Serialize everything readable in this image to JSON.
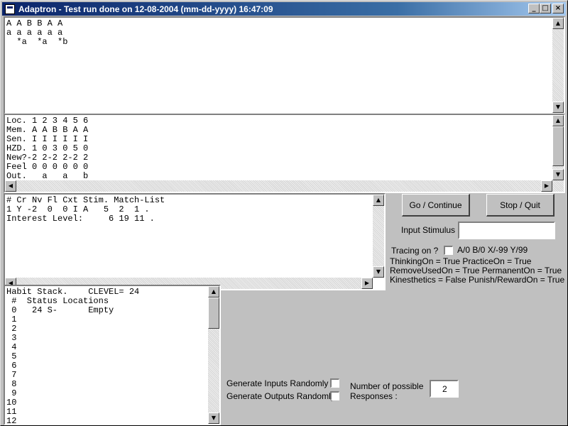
{
  "window": {
    "title": "Adaptron - Test run done on 12-08-2004 (mm-dd-yyyy) 16:47:09",
    "controls": {
      "minimize": "_",
      "maximize": "□",
      "close": "×"
    }
  },
  "top_output": {
    "lines": "A A B B A A\na a a a a a\n  *a  *a  *b"
  },
  "memory_table": {
    "lines": "Loc. 1 2 3 4 5 6\nMem. A A B B A A\nSen. I I I I I I\nHZD. 1 0 3 0 5 0\nNew?-2 2-2 2-2 2\nFeel 0 0 0 0 0 0\nOut.   a   a   b"
  },
  "match_list": {
    "lines": "# Cr Nv Fl Cxt Stim. Match-List\n1 Y -2  0  0 I A   5  2  1 .\nInterest Level:     6 19 11 ."
  },
  "habit_stack": {
    "lines": "Habit Stack.    CLEVEL= 24\n #  Status Locations\n 0   24 S-      Empty\n 1\n 2\n 3\n 4\n 5\n 6\n 7\n 8\n 9\n10\n11\n12"
  },
  "controls": {
    "go_continue": "Go / Continue",
    "stop_quit": "Stop / Quit",
    "input_stimulus_label": "Input Stimulus :",
    "input_stimulus_value": "",
    "tracing_label": "Tracing on ?",
    "tracing_checked": false,
    "tracing_options": "A/0  B/0  X/-99  Y/99",
    "flags_line1": "ThinkingOn = True PracticeOn = True",
    "flags_line2": "RemoveUsedOn = True PermanentOn = True",
    "flags_line3": "Kinesthetics = False Punish/RewardOn = True",
    "gen_inputs_label": "Generate Inputs Randomly ?",
    "gen_inputs_checked": false,
    "gen_outputs_label": "Generate Outputs Randomly?",
    "gen_outputs_checked": false,
    "num_responses_label_1": "Number of possible",
    "num_responses_label_2": "Responses :",
    "num_responses_value": "2"
  },
  "scroll_glyphs": {
    "up": "▲",
    "down": "▼",
    "left": "◀",
    "right": "▶"
  }
}
